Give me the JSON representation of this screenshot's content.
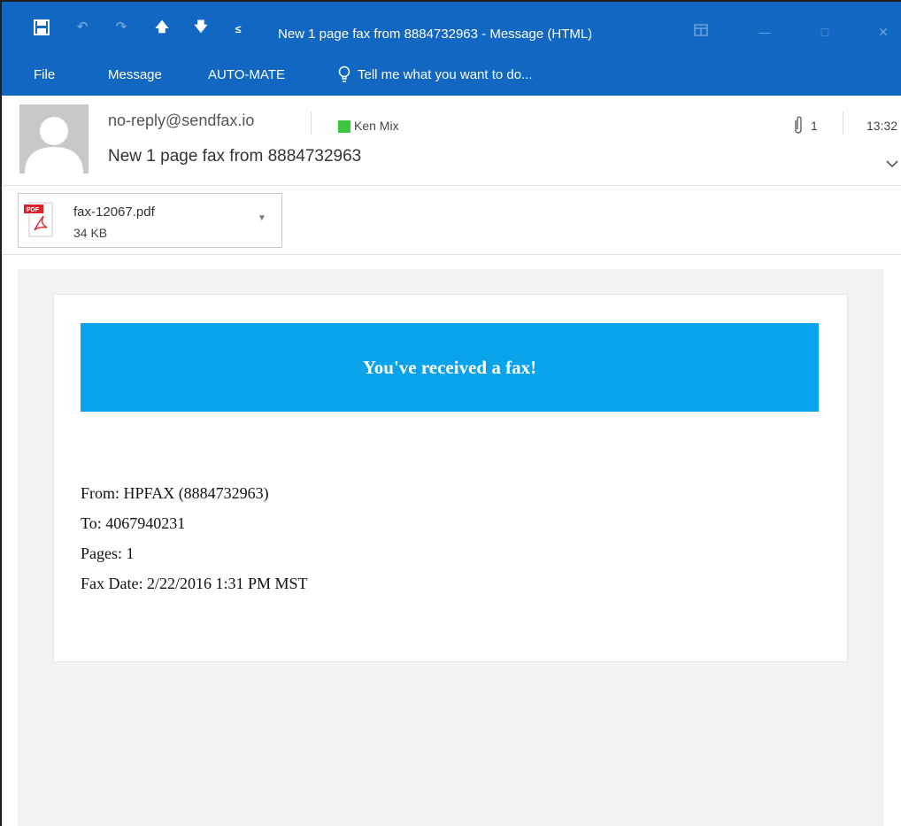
{
  "window": {
    "title": "New 1 page fax from 8884732963 - Message (HTML)"
  },
  "ribbon": {
    "tabs": [
      "File",
      "Message",
      "AUTO-MATE"
    ],
    "tell_me": "Tell me what you want to do..."
  },
  "message": {
    "sender": "no-reply@sendfax.io",
    "category": {
      "label": "Ken Mix",
      "color": "#3cc640"
    },
    "subject": "New 1 page fax from 8884732963",
    "attachment_count": "1",
    "time": "13:32"
  },
  "attachment": {
    "name": "fax-12067.pdf",
    "size": "34 KB",
    "type_badge": "PDF"
  },
  "email_body": {
    "banner": "You've received a fax!",
    "banner_color": "#09a3ec",
    "lines": [
      "From: HPFAX (8884732963)",
      "To: 4067940231",
      "Pages: 1",
      "Fax Date: 2/22/2016 1:31 PM MST"
    ]
  },
  "colors": {
    "titlebar": "#1167c1"
  }
}
